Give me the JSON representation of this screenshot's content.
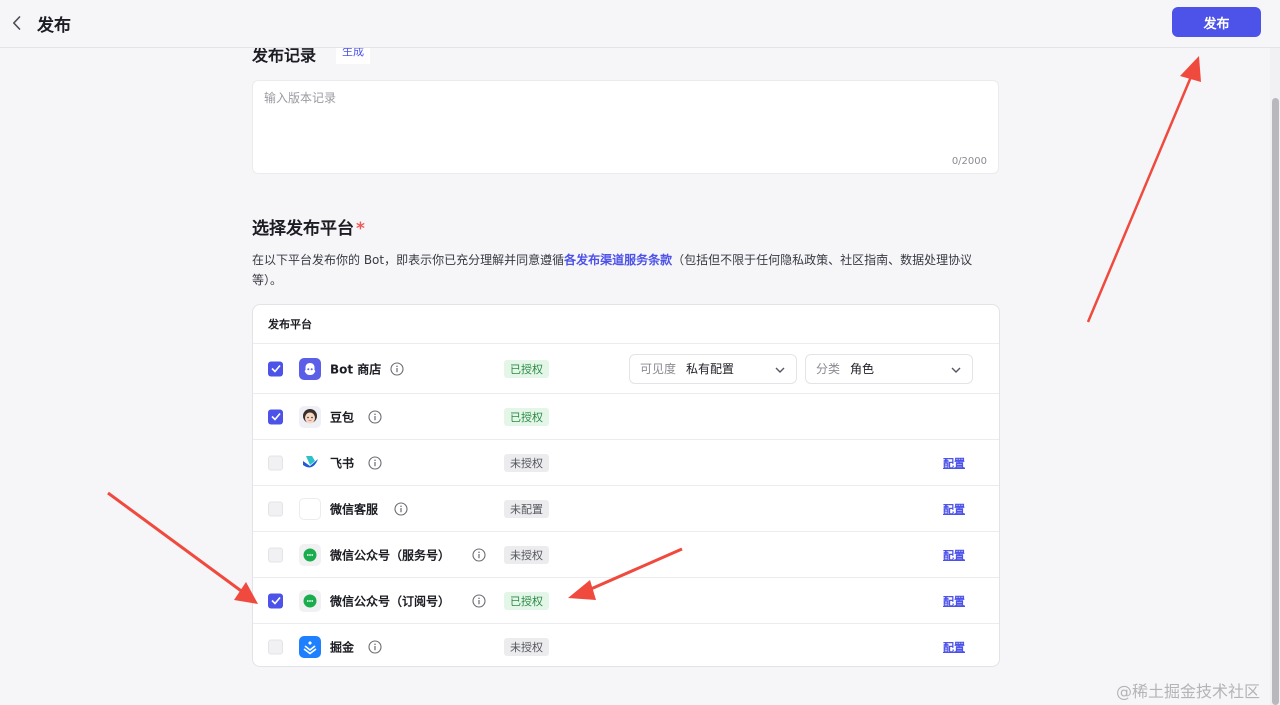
{
  "header": {
    "title": "发布",
    "publish_label": "发布"
  },
  "record": {
    "heading": "发布记录",
    "generate_label": "生成",
    "placeholder": "输入版本记录",
    "counter": "0/2000"
  },
  "platform_section": {
    "title": "选择发布平台",
    "required_mark": "*",
    "desc_before": "在以下平台发布你的 Bot，即表示你已充分理解并同意遵循",
    "desc_link": "各发布渠道服务条款",
    "desc_after": "（包括但不限于任何隐私政策、社区指南、数据处理协议等）。",
    "column_header": "发布平台"
  },
  "platforms": [
    {
      "name": "Bot 商店",
      "status": "已授权",
      "checked": true,
      "icon": "bot-store-icon"
    },
    {
      "name": "豆包",
      "status": "已授权",
      "checked": true,
      "icon": "doubao-icon"
    },
    {
      "name": "飞书",
      "status": "未授权",
      "checked": false,
      "icon": "feishu-icon",
      "config": "配置"
    },
    {
      "name": "微信客服",
      "status": "未配置",
      "checked": false,
      "icon": "wechat-service-icon",
      "config": "配置"
    },
    {
      "name": "微信公众号（服务号）",
      "status": "未授权",
      "checked": false,
      "icon": "wechat-icon",
      "config": "配置"
    },
    {
      "name": "微信公众号（订阅号）",
      "status": "已授权",
      "checked": true,
      "icon": "wechat-icon",
      "config": "配置"
    },
    {
      "name": "掘金",
      "status": "未授权",
      "checked": false,
      "icon": "juejin-icon",
      "config": "配置"
    }
  ],
  "bot_store_options": {
    "visibility_label": "可见度",
    "visibility_value": "私有配置",
    "category_label": "分类",
    "category_value": "角色"
  },
  "watermark": "@稀土掘金技术社区",
  "colors": {
    "accent": "#4d53e8",
    "authorized_bg": "#e3f6e8",
    "authorized_text": "#2d8a45",
    "annotation_arrow": "#f04a3e"
  }
}
